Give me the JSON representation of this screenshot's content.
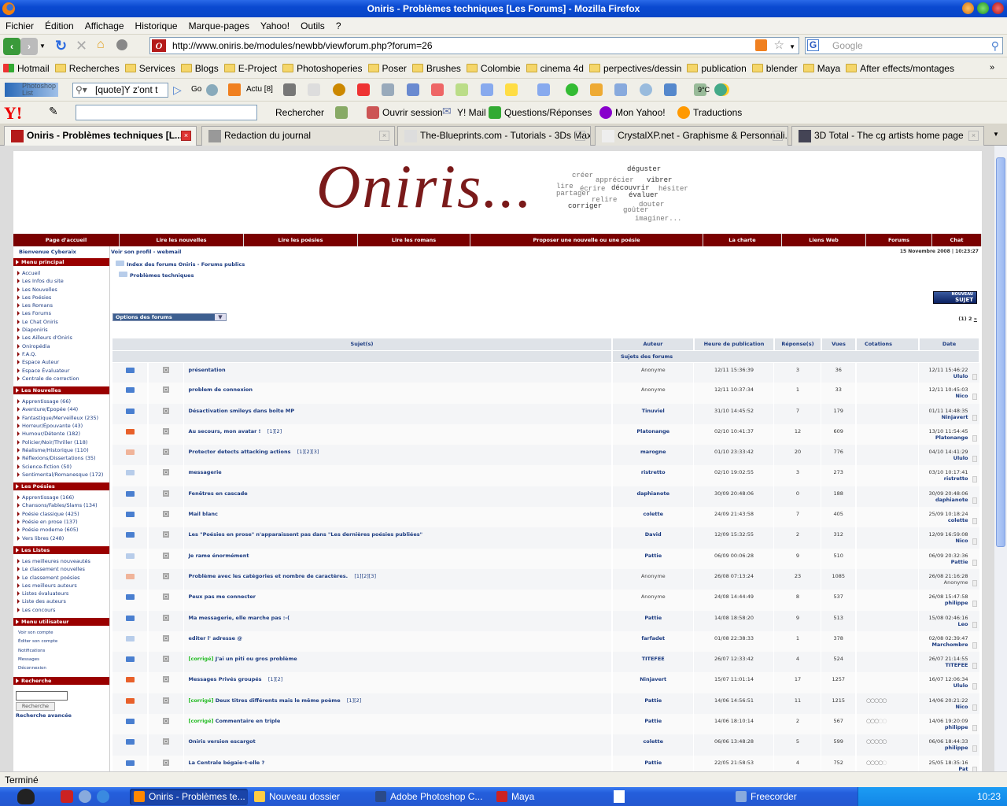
{
  "window": {
    "title": "Oniris - Problèmes techniques [Les Forums] - Mozilla Firefox"
  },
  "menu": [
    "Fichier",
    "Édition",
    "Affichage",
    "Historique",
    "Marque-pages",
    "Yahoo!",
    "Outils",
    "?"
  ],
  "nav": {
    "url": "http://www.oniris.be/modules/newbb/viewforum.php?forum=26",
    "search_placeholder": "Google"
  },
  "bookmarks": [
    "Hotmail",
    "Recherches",
    "Services",
    "Blogs",
    "E-Project",
    "Photoshoperies",
    "Poser",
    "Brushes",
    "Colombie",
    "cinema 4d",
    "perpectives/dessin",
    "publication",
    "blender",
    "Maya",
    "After effects/montages"
  ],
  "toolbar2": {
    "logo": "Photoshop List",
    "search_value": "[quote]Y z'ont t",
    "go": "Go",
    "actu": "Actu [8]",
    "weather": "9°C"
  },
  "yahoo": {
    "search": "Rechercher",
    "login": "Ouvrir session",
    "mail": "Y! Mail",
    "qa": "Questions/Réponses",
    "my": "Mon Yahoo!",
    "translate": "Traductions"
  },
  "tabs": [
    {
      "label": "Oniris - Problèmes techniques [L...",
      "active": true
    },
    {
      "label": "Redaction du journal"
    },
    {
      "label": "The-Blueprints.com - Tutorials - 3Ds Max"
    },
    {
      "label": "CrystalXP.net - Graphisme & Personnali..."
    },
    {
      "label": "3D Total - The cg artists home page"
    }
  ],
  "site": {
    "logo": "Oniris...",
    "logo_words": [
      "déguster",
      "créer",
      "apprécier",
      "vibrer",
      "lire",
      "écrire",
      "découvrir",
      "hésiter",
      "partager",
      "évaluer",
      "relire",
      "douter",
      "corriger",
      "goûter",
      "imaginer..."
    ],
    "topnav": [
      "Page d'accueil",
      "Lire les nouvelles",
      "Lire les poésies",
      "Lire les romans",
      "Proposer une nouvelle ou une poésie",
      "La charte",
      "Liens Web",
      "Forums",
      "Chat"
    ],
    "welcome": "Bienvenue Cyberaix",
    "sections": [
      {
        "title": "Menu principal",
        "items": [
          "Accueil",
          "Les Infos du site",
          "Les Nouvelles",
          "Les Poésies",
          "Les Romans",
          "Les Forums",
          "Le Chat Oniris",
          "Diaponiris",
          "Les Ailleurs d'Oniris",
          "Oniropédia",
          "F.A.Q.",
          "Espace Auteur",
          "Espace Évaluateur",
          "Centrale de correction"
        ]
      },
      {
        "title": "Les Nouvelles",
        "items": [
          "Apprentissage (66)",
          "Aventure/Epopée (44)",
          "Fantastique/Merveilleux (235)",
          "Horreur/Épouvante (43)",
          "Humour/Détente (182)",
          "Policier/Noir/Thriller (118)",
          "Réalisme/Historique (110)",
          "Réflexions/Dissertations (35)",
          "Science-fiction (50)",
          "Sentimental/Romanesque (172)"
        ]
      },
      {
        "title": "Les Poésies",
        "items": [
          "Apprentissage (166)",
          "Chansons/Fables/Slams (134)",
          "Poésie classique (425)",
          "Poésie en prose (137)",
          "Poésie moderne (605)",
          "Vers libres (248)"
        ]
      },
      {
        "title": "Les Listes",
        "items": [
          "Les meilleures nouveautés",
          "Le classement nouvelles",
          "Le classement poésies",
          "Les meilleurs auteurs",
          "Listes évaluateurs",
          "Liste des auteurs",
          "Les concours"
        ]
      },
      {
        "title": "Menu utilisateur",
        "items": [
          "Voir son compte",
          "Éditer son compte",
          "Notifications",
          "Messages",
          "Déconnexion"
        ],
        "small": true
      },
      {
        "title": "Recherche",
        "items": []
      }
    ],
    "search_button": "Recherche",
    "advanced_search": "Recherche avancée",
    "profile_links": "Voir son profil  - webmail",
    "datetime": "15 Novembre 2008 | 10:23:27",
    "breadcrumb": [
      "Index des forums Oniris - Forums publics",
      "Problèmes techniques"
    ],
    "new_topic": {
      "line1": "NOUVEAU",
      "line2": "SUJET"
    },
    "forum_options": "Options des forums",
    "pagination": {
      "current": "(1)",
      "next": "2",
      "more": "»"
    },
    "columns": [
      "Sujet(s)",
      "Auteur",
      "Heure de publication",
      "Réponse(s)",
      "Vues",
      "Cotations",
      "Date"
    ],
    "subheader": "Sujets des forums",
    "status_colors": {
      "new": "#4a7fd0",
      "hot": "#e8602a",
      "hot_read": "#f0b49a",
      "read": "#b8cdea"
    },
    "topics": [
      {
        "icon": "new",
        "tag": "",
        "title": "présentation",
        "pages": "",
        "author": "Anonyme",
        "anon": true,
        "posted": "12/11 15:36:39",
        "replies": "3",
        "views": "36",
        "rating": null,
        "last_date": "12/11 15:46:22",
        "last_by": "Ululo"
      },
      {
        "icon": "new",
        "tag": "",
        "title": "problem de connexion",
        "pages": "",
        "author": "Anonyme",
        "anon": true,
        "posted": "12/11 10:37:34",
        "replies": "1",
        "views": "33",
        "rating": null,
        "last_date": "12/11 10:45:03",
        "last_by": "Nico"
      },
      {
        "icon": "new",
        "tag": "",
        "title": "Désactivation smileys dans boîte MP",
        "pages": "",
        "author": "Tinuviel",
        "posted": "31/10 14:45:52",
        "replies": "7",
        "views": "179",
        "rating": null,
        "last_date": "01/11 14:48:35",
        "last_by": "Ninjavert"
      },
      {
        "icon": "hot",
        "tag": "",
        "title": "Au secours, mon avatar !",
        "pages": "[1][2]",
        "author": "Platonange",
        "posted": "02/10 10:41:37",
        "replies": "12",
        "views": "609",
        "rating": null,
        "last_date": "13/10 11:54:45",
        "last_by": "Platonange"
      },
      {
        "icon": "hot_read",
        "tag": "",
        "title": "Protector detects attacking actions",
        "pages": "[1][2][3]",
        "author": "marogne",
        "posted": "01/10 23:33:42",
        "replies": "20",
        "views": "776",
        "rating": null,
        "last_date": "04/10 14:41:29",
        "last_by": "Ululo"
      },
      {
        "icon": "read",
        "tag": "",
        "title": "messagerie",
        "pages": "",
        "author": "ristretto",
        "posted": "02/10 19:02:55",
        "replies": "3",
        "views": "273",
        "rating": null,
        "last_date": "03/10 10:17:41",
        "last_by": "ristretto"
      },
      {
        "icon": "new",
        "tag": "",
        "title": "Fenêtres en cascade",
        "pages": "",
        "author": "daphianote",
        "posted": "30/09 20:48:06",
        "replies": "0",
        "views": "188",
        "rating": null,
        "last_date": "30/09 20:48:06",
        "last_by": "daphianote"
      },
      {
        "icon": "new",
        "tag": "",
        "title": "Mail blanc",
        "pages": "",
        "author": "colette",
        "posted": "24/09 21:43:58",
        "replies": "7",
        "views": "405",
        "rating": null,
        "last_date": "25/09 10:18:24",
        "last_by": "colette"
      },
      {
        "icon": "new",
        "tag": "",
        "title": "Les \"Poésies en prose\" n'apparaissent pas dans \"Les dernières poésies publiées\"",
        "pages": "",
        "author": "David",
        "posted": "12/09 15:32:55",
        "replies": "2",
        "views": "312",
        "rating": null,
        "last_date": "12/09 16:59:08",
        "last_by": "Nico"
      },
      {
        "icon": "read",
        "tag": "",
        "title": "Je rame énormément",
        "pages": "",
        "author": "Pattie",
        "posted": "06/09 00:06:28",
        "replies": "9",
        "views": "510",
        "rating": null,
        "last_date": "06/09 20:32:36",
        "last_by": "Pattie"
      },
      {
        "icon": "hot_read",
        "tag": "",
        "title": "Problème avec les catégories et nombre de caractères.",
        "pages": "[1][2][3]",
        "author": "Anonyme",
        "anon": true,
        "posted": "26/08 07:13:24",
        "replies": "23",
        "views": "1085",
        "rating": null,
        "last_date": "26/08 21:16:28",
        "last_by": "Anonyme",
        "last_anon": true
      },
      {
        "icon": "new",
        "tag": "",
        "title": "Peux pas me connecter",
        "pages": "",
        "author": "Anonyme",
        "anon": true,
        "posted": "24/08 14:44:49",
        "replies": "8",
        "views": "537",
        "rating": null,
        "last_date": "26/08 15:47:58",
        "last_by": "philippe"
      },
      {
        "icon": "new",
        "tag": "",
        "title": "Ma messagerie, elle marche pas :-(",
        "pages": "",
        "author": "Pattie",
        "posted": "14/08 18:58:20",
        "replies": "9",
        "views": "513",
        "rating": null,
        "last_date": "15/08 02:46:16",
        "last_by": "Leo"
      },
      {
        "icon": "read",
        "tag": "",
        "title": "editer l' adresse @",
        "pages": "",
        "author": "farfadet",
        "posted": "01/08 22:38:33",
        "replies": "1",
        "views": "378",
        "rating": null,
        "last_date": "02/08 02:39:47",
        "last_by": "Marchombre"
      },
      {
        "icon": "new",
        "tag": "[corrigé]",
        "title": "J'ai un piti ou gros problème",
        "pages": "",
        "author": "TITEFEE",
        "posted": "26/07 12:33:42",
        "replies": "4",
        "views": "524",
        "rating": null,
        "last_date": "26/07 21:14:55",
        "last_by": "TITEFEE"
      },
      {
        "icon": "hot",
        "tag": "",
        "title": "Messages Privés groupés",
        "pages": "[1][2]",
        "author": "Ninjavert",
        "posted": "15/07 11:01:14",
        "replies": "17",
        "views": "1257",
        "rating": null,
        "last_date": "16/07 12:06:34",
        "last_by": "Ululo"
      },
      {
        "icon": "hot",
        "tag": "[corrigé]",
        "title": "Deux titres différents mais le même poème",
        "pages": "[1][2]",
        "author": "Pattie",
        "posted": "14/06 14:56:51",
        "replies": "11",
        "views": "1215",
        "rating": 5,
        "last_date": "14/06 20:21:22",
        "last_by": "Nico"
      },
      {
        "icon": "new",
        "tag": "[corrigé]",
        "title": "Commentaire en triple",
        "pages": "",
        "author": "Pattie",
        "posted": "14/06 18:10:14",
        "replies": "2",
        "views": "567",
        "rating": 3,
        "last_date": "14/06 19:20:09",
        "last_by": "philippe"
      },
      {
        "icon": "new",
        "tag": "",
        "title": "Oniris version escargot",
        "pages": "",
        "author": "colette",
        "posted": "06/06 13:48:28",
        "replies": "5",
        "views": "599",
        "rating": 5,
        "last_date": "06/06 18:44:33",
        "last_by": "philippe"
      },
      {
        "icon": "new",
        "tag": "",
        "title": "La Centrale bégaie-t-elle ?",
        "pages": "",
        "author": "Pattie",
        "posted": "22/05 21:58:53",
        "replies": "4",
        "views": "752",
        "rating": 4,
        "last_date": "25/05 18:35:16",
        "last_by": "Pat"
      }
    ]
  },
  "statusbar": "Terminé",
  "taskbar": {
    "items": [
      "Oniris - Problèmes te...",
      "Nouveau dossier",
      "Adobe Photoshop C...",
      "Maya",
      "Freecorder"
    ],
    "clock": "10:23"
  }
}
